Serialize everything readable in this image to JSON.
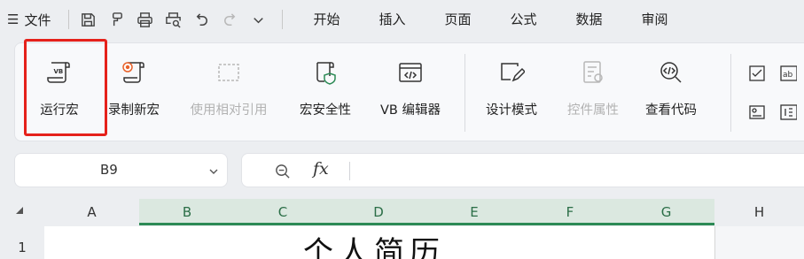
{
  "menubar": {
    "hamburger_glyph": "☰",
    "file_label": "文件",
    "tabs": [
      "开始",
      "插入",
      "页面",
      "公式",
      "数据",
      "审阅"
    ]
  },
  "quick_access": {
    "icons": [
      "save-icon",
      "format-painter-icon",
      "print-icon",
      "print-preview-icon",
      "undo-icon",
      "redo-icon",
      "more-icon"
    ]
  },
  "ribbon": {
    "buttons": [
      {
        "label": "运行宏",
        "icon": "run-macro-icon",
        "enabled": true
      },
      {
        "label": "录制新宏",
        "icon": "record-macro-icon",
        "enabled": true
      },
      {
        "label": "使用相对引用",
        "icon": "relative-reference-icon",
        "enabled": false
      },
      {
        "label": "宏安全性",
        "icon": "macro-security-icon",
        "enabled": true
      },
      {
        "label": "VB 编辑器",
        "icon": "vb-editor-icon",
        "enabled": true
      },
      {
        "label": "设计模式",
        "icon": "design-mode-icon",
        "enabled": true
      },
      {
        "label": "控件属性",
        "icon": "control-properties-icon",
        "enabled": false
      },
      {
        "label": "查看代码",
        "icon": "view-code-icon",
        "enabled": true
      }
    ],
    "mini_controls": [
      "checkbox-control-icon",
      "label-control-icon",
      "groupbox-control-icon",
      "numbered-control-icon"
    ],
    "highlight_color": "#e5211b"
  },
  "formula_bar": {
    "cell_reference": "B9",
    "fx_label": "fx",
    "value": ""
  },
  "grid": {
    "columns": [
      "A",
      "B",
      "C",
      "D",
      "E",
      "F",
      "G",
      "H"
    ],
    "selected_columns": [
      "B",
      "C",
      "D",
      "E",
      "F",
      "G"
    ],
    "rows": [
      "1"
    ],
    "cells": {
      "B1": "个人简历"
    },
    "select_color": "#2c8a55"
  }
}
